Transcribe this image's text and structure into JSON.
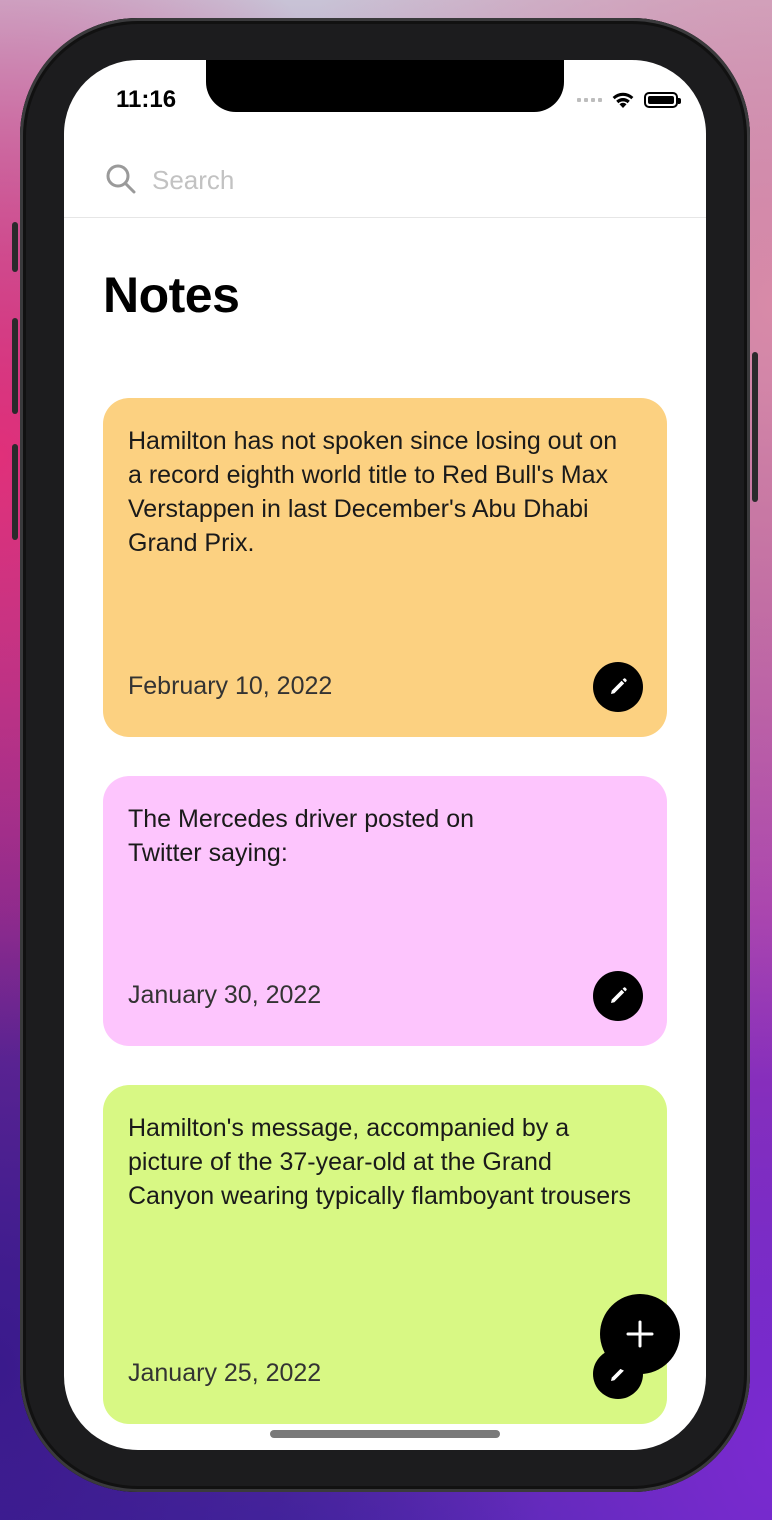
{
  "status_bar": {
    "time": "11:16"
  },
  "search": {
    "placeholder": "Search",
    "value": ""
  },
  "page": {
    "title": "Notes"
  },
  "notes": [
    {
      "text": "Hamilton has not spoken since losing out on a record eighth world title to Red Bull's Max Verstappen in last December's Abu Dhabi Grand Prix.",
      "date": "February 10, 2022",
      "color": "#fcd181"
    },
    {
      "text": "The Mercedes driver posted on Twitter saying:",
      "date": "January 30, 2022",
      "color": "#fdc5fd"
    },
    {
      "text": "Hamilton's message, accompanied by a picture of the 37-year-old at the Grand Canyon wearing typically flamboyant trousers",
      "date": "January 25, 2022",
      "color": "#d8f884"
    }
  ],
  "icons": {
    "search": "search-icon",
    "edit": "pencil-icon",
    "add": "plus-icon",
    "wifi": "wifi-icon",
    "battery": "battery-icon",
    "signal": "signal-icon"
  }
}
